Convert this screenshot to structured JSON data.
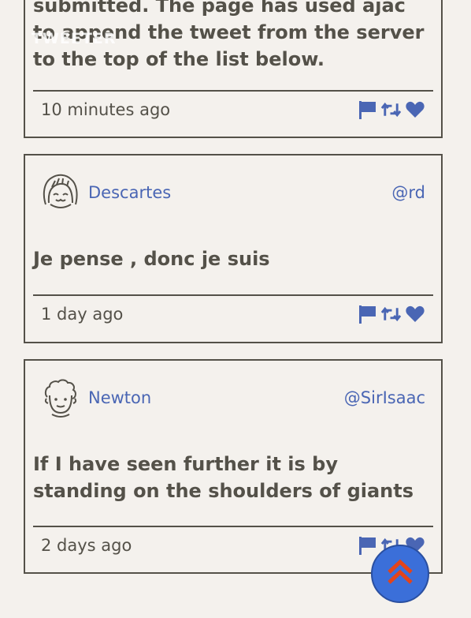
{
  "overlay_text": "TWEETER",
  "tweets": [
    {
      "text": "submitted. The page has used ajac to append the tweet from the server to the top of the list below.",
      "timestamp": "10 minutes ago"
    },
    {
      "name": "Descartes",
      "handle": "@rd",
      "text": "Je pense , donc je suis",
      "timestamp": "1 day ago"
    },
    {
      "name": "Newton",
      "handle": "@SirIsaac",
      "text": "If I have seen further it is by standing on the shoulders of giants",
      "timestamp": "2 days ago"
    }
  ],
  "icons": {
    "flag": "flag-icon",
    "retweet": "retweet-icon",
    "like": "heart-icon",
    "scroll_top": "double-chevron-up-icon"
  },
  "colors": {
    "background": "#f4f1ed",
    "text": "#545149",
    "link": "#4a66b4",
    "scroll_button": "#3b6fd9",
    "scroll_chevron": "#e3441a"
  }
}
